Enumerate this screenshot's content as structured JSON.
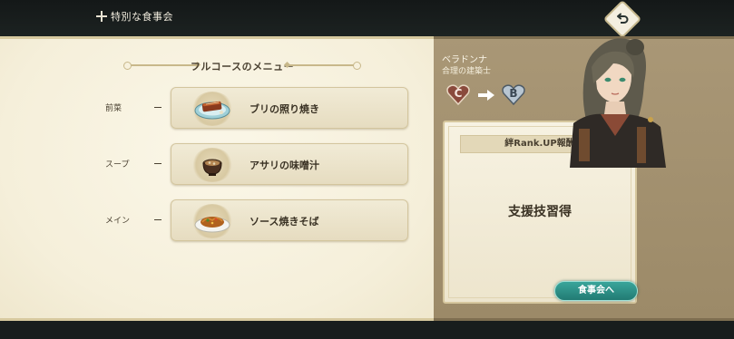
{
  "header": {
    "title": "特別な食事会",
    "title_icon": "cross-ornament-icon",
    "back_icon": "return-arrow-icon"
  },
  "menu": {
    "heading": "フルコースのメニュー",
    "courses": [
      {
        "label": "前菜",
        "dish": "ブリの照り焼き",
        "dish_icon": "teriyaki-fish-dish-icon"
      },
      {
        "label": "スープ",
        "dish": "アサリの味噌汁",
        "dish_icon": "miso-soup-bowl-icon"
      },
      {
        "label": "メイン",
        "dish": "ソース焼きそば",
        "dish_icon": "yakisoba-plate-icon"
      }
    ]
  },
  "character": {
    "name": "ベラドンナ",
    "title": "合理の建築士",
    "rank_from": "C",
    "rank_to": "B",
    "rank_from_color": "#8a4a3c",
    "rank_to_color": "#b8c6d2"
  },
  "reward": {
    "header": "絆Rank.UP報酬",
    "body": "支援技習得"
  },
  "actions": {
    "dinner_button": "食事会へ",
    "dinner_button_color": "#2a8f86"
  }
}
